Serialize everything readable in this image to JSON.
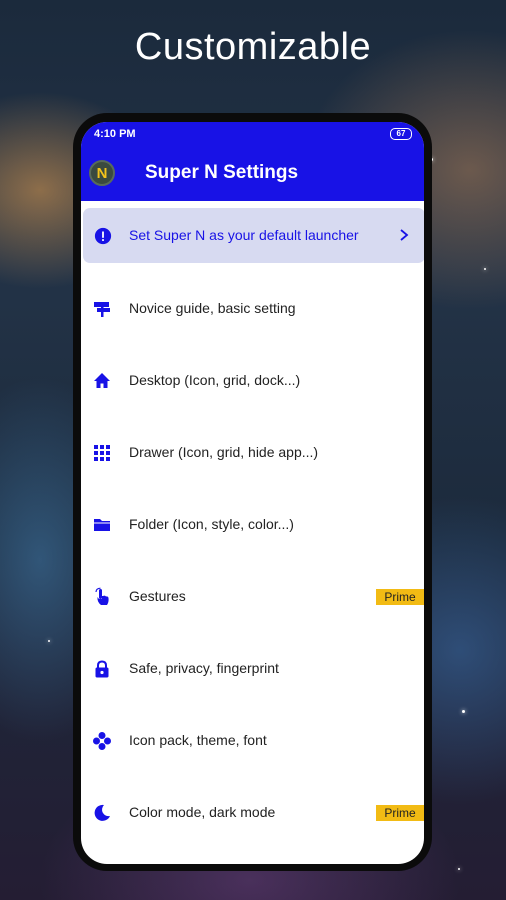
{
  "headline": "Customizable",
  "status": {
    "time": "4:10 PM",
    "battery": "67"
  },
  "app": {
    "title": "Super N Settings",
    "logo_letter": "N"
  },
  "banner": {
    "label": "Set Super N as your default launcher",
    "icon": "info-icon"
  },
  "items": [
    {
      "label": "Novice guide, basic setting",
      "icon": "signpost-icon"
    },
    {
      "label": "Desktop (Icon, grid, dock...)",
      "icon": "home-icon"
    },
    {
      "label": "Drawer (Icon, grid, hide app...)",
      "icon": "grid-icon"
    },
    {
      "label": "Folder (Icon, style, color...)",
      "icon": "folder-icon"
    },
    {
      "label": "Gestures",
      "icon": "gesture-icon",
      "badge": "Prime"
    },
    {
      "label": "Safe, privacy, fingerprint",
      "icon": "lock-icon"
    },
    {
      "label": "Icon pack, theme, font",
      "icon": "theme-icon"
    },
    {
      "label": "Color mode, dark mode",
      "icon": "moon-icon",
      "badge": "Prime"
    }
  ],
  "colors": {
    "accent": "#1812e6",
    "badge": "#f2bb14",
    "banner_bg": "#d7daf1"
  }
}
